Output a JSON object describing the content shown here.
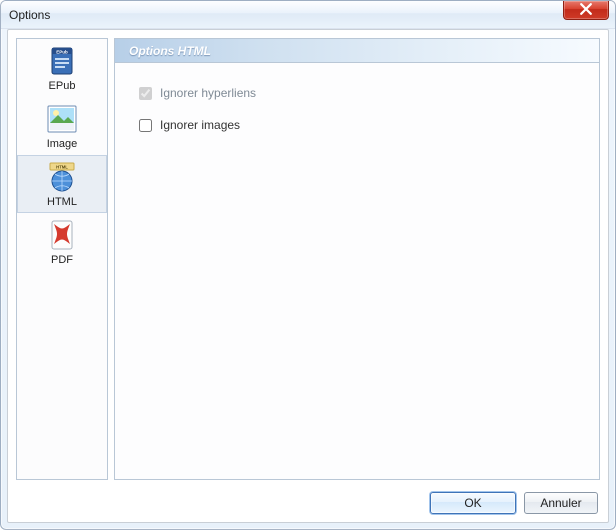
{
  "window": {
    "title": "Options"
  },
  "sidebar": {
    "items": [
      {
        "label": "EPub",
        "icon": "epub-icon",
        "selected": false
      },
      {
        "label": "Image",
        "icon": "image-icon",
        "selected": false
      },
      {
        "label": "HTML",
        "icon": "html-icon",
        "selected": true
      },
      {
        "label": "PDF",
        "icon": "pdf-icon",
        "selected": false
      }
    ]
  },
  "panel": {
    "header": "Options HTML",
    "options": {
      "ignore_hyperlinks": {
        "label": "Ignorer hyperliens",
        "checked": true,
        "enabled": false
      },
      "ignore_images": {
        "label": "Ignorer images",
        "checked": false,
        "enabled": true
      }
    }
  },
  "buttons": {
    "ok": "OK",
    "cancel": "Annuler"
  }
}
